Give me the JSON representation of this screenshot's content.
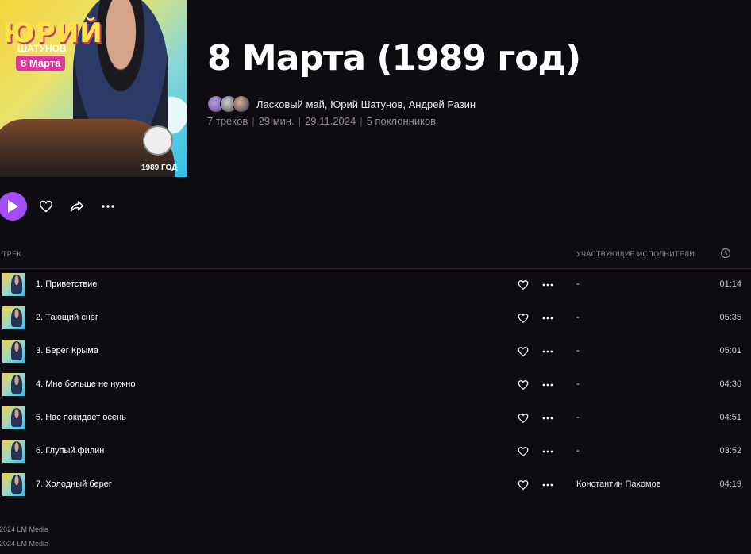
{
  "album": {
    "title": "8 Марта (1989 год)",
    "cover": {
      "title_line1": "ЮРИЙ",
      "title_line2": "ШАТУНОВ",
      "badge": "8 Марта",
      "year": "1989 ГОД"
    },
    "artists": "Ласковый май, Юрий Шатунов, Андрей Разин",
    "meta": [
      "7 треков",
      "29 мин.",
      "29.11.2024",
      "5 поклонников"
    ]
  },
  "colors": {
    "background": "#0e0b11",
    "accent": "#a54ef7",
    "muted_text": "#8f8a96"
  },
  "controls": {
    "play_icon": "play-icon",
    "like_icon": "heart-icon",
    "share_icon": "share-icon",
    "more_icon": "more-icon"
  },
  "table": {
    "header_track": "ТРЕК",
    "header_artists": "УЧАСТВУЮЩИЕ ИСПОЛНИТЕЛИ",
    "header_time_icon": "clock-icon"
  },
  "tracks": [
    {
      "name": "1. Приветствие",
      "artists": "-",
      "duration": "01:14"
    },
    {
      "name": "2. Тающий снег",
      "artists": "-",
      "duration": "05:35"
    },
    {
      "name": "3. Берег Крыма",
      "artists": "-",
      "duration": "05:01"
    },
    {
      "name": "4. Мне больше не нужно",
      "artists": "-",
      "duration": "04:36"
    },
    {
      "name": "5. Нас покидает осень",
      "artists": "-",
      "duration": "04:51"
    },
    {
      "name": "6. Глупый филин",
      "artists": "-",
      "duration": "03:52"
    },
    {
      "name": "7. Холодный берег",
      "artists": "Константин Пахомов",
      "duration": "04:19"
    }
  ],
  "footer": {
    "copyright1": "2024 LM Media",
    "copyright2": "2024 LM Media"
  }
}
